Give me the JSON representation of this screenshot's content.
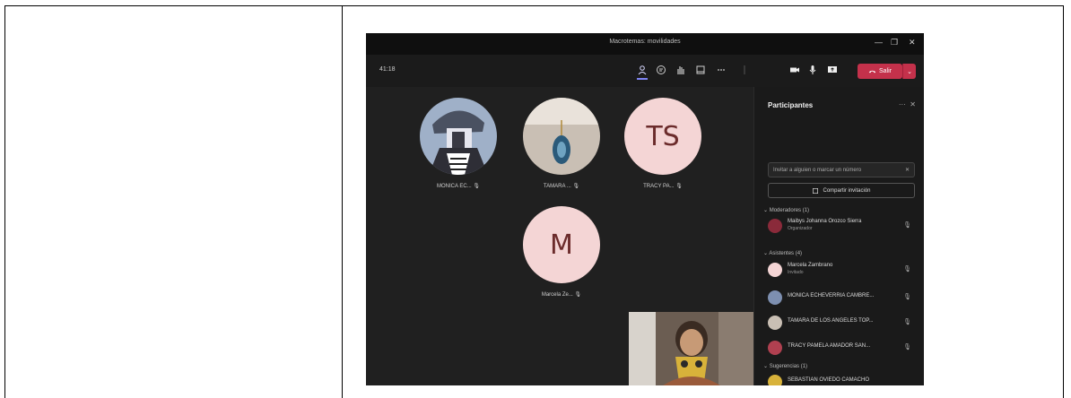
{
  "window": {
    "title": "Macrotemas: movilidades",
    "controls": {
      "minimize": "—",
      "restore": "❐",
      "close": "✕"
    }
  },
  "toolbar": {
    "timer": "41:18",
    "leave_label": "Salir",
    "leave_menu": "⌄"
  },
  "tiles": [
    {
      "name": "MONICA EC...",
      "type": "photo"
    },
    {
      "name": "TAMARA ...",
      "type": "photo"
    },
    {
      "name": "TRACY PA...",
      "type": "initials",
      "initials": "TS"
    },
    {
      "name": "Marcela Ze...",
      "type": "initials",
      "initials": "M"
    }
  ],
  "panel": {
    "title": "Participantes",
    "invite_placeholder": "Invitar a alguien o marcar un número",
    "share_label": "Compartir invitación",
    "sections": {
      "moderators": "Moderadores (1)",
      "attendees": "Asistentes (4)",
      "suggestions": "Sugerencias (1)"
    },
    "moderators": [
      {
        "name": "Maibys Johanna Orozco Sierra",
        "role": "Organizador"
      }
    ],
    "attendees": [
      {
        "name": "Marcela Zambrano",
        "role": "Invitado"
      },
      {
        "name": "MONICA ECHEVERRIA CAMBRE...",
        "role": ""
      },
      {
        "name": "TAMARA DE LOS ANGELES TOP...",
        "role": ""
      },
      {
        "name": "TRACY PAMELA AMADOR SAN...",
        "role": ""
      }
    ],
    "suggestions": [
      {
        "name": "SEBASTIAN OVIEDO CAMACHO",
        "role": ""
      }
    ]
  },
  "colors": {
    "leave": "#c4314b",
    "accent": "#7f85f5",
    "initials_bg": "#f4d5d5"
  }
}
